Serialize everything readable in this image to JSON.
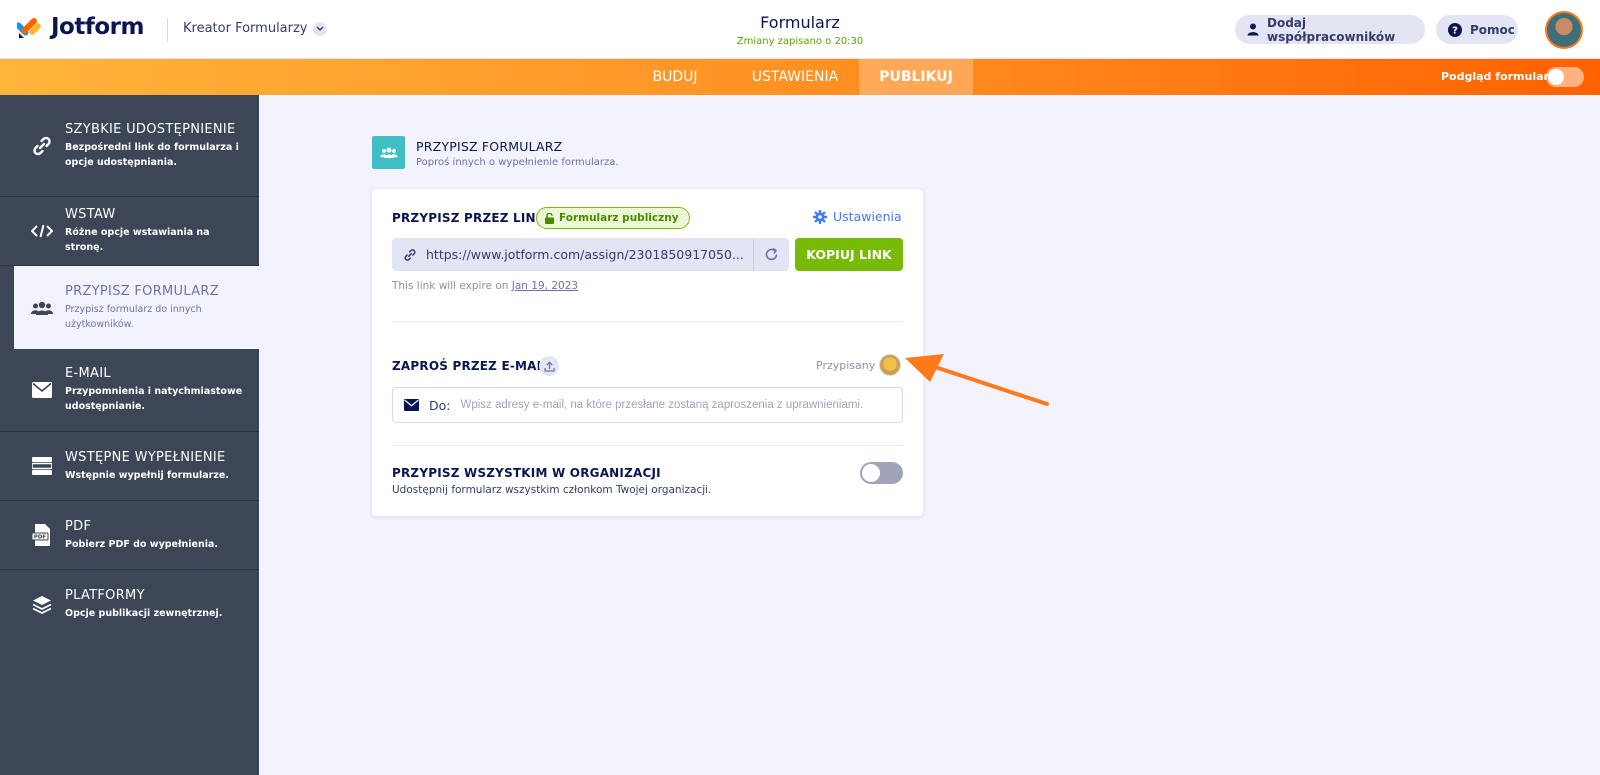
{
  "header": {
    "logo_text": "Jotform",
    "builder_label": "Kreator Formularzy",
    "form_title": "Formularz",
    "saved_status": "Zmiany zapisano o 20:30",
    "add_collaborators": "Dodaj współpracowników",
    "help": "Pomoc"
  },
  "nav": {
    "tabs": [
      "BUDUJ",
      "USTAWIENIA",
      "PUBLIKUJ"
    ],
    "active_tab": "PUBLIKUJ",
    "preview_label": "Podgląd formularza",
    "preview_on": false
  },
  "sidebar": {
    "items": [
      {
        "title": "SZYBKIE UDOSTĘPNIENIE",
        "subtitle": "Bezpośredni link do formularza i opcje udostępniania.",
        "icon": "link-icon"
      },
      {
        "title": "WSTAW",
        "subtitle": "Różne opcje wstawiania na stronę.",
        "icon": "code-icon"
      },
      {
        "title": "PRZYPISZ FORMULARZ",
        "subtitle": "Przypisz formularz do innych użytkowników.",
        "icon": "users-icon"
      },
      {
        "title": "E-MAIL",
        "subtitle": "Przypomnienia i natychmiastowe udostępnianie.",
        "icon": "envelope-icon"
      },
      {
        "title": "WSTĘPNE WYPEŁNIENIE",
        "subtitle": "Wstępnie wypełnij formularze.",
        "icon": "prefill-icon"
      },
      {
        "title": "PDF",
        "subtitle": "Pobierz PDF do wypełnienia.",
        "icon": "pdf-icon"
      },
      {
        "title": "PLATFORMY",
        "subtitle": "Opcje publikacji zewnętrznej.",
        "icon": "layers-icon"
      }
    ],
    "active_index": 2
  },
  "main": {
    "section_title": "PRZYPISZ FORMULARZ",
    "section_subtitle": "Poproś innych o wypełnienie formularza.",
    "assign_link_label": "PRZYPISZ PRZEZ LINK",
    "public_badge": "Formularz publiczny",
    "settings_link": "Ustawienia",
    "link_url": "https://www.jotform.com/assign/2301850917050...",
    "copy_button": "KOPIUJ LINK",
    "expire_prefix": "This link will expire on ",
    "expire_date": "Jan 19, 2023",
    "invite_label": "ZAPROŚ PRZEZ E-MAIL",
    "assigned_label": "Przypisany",
    "to_label": "Do:",
    "email_placeholder": "Wpisz adresy e-mail, na które przesłane zostaną zaproszenia z uprawnieniami.",
    "org_label": "PRZYPISZ WSZYSTKIM W ORGANIZACJI",
    "org_subtitle": "Udostępnij formularz wszystkim członkom Twojej organizacji.",
    "org_toggle_on": false
  },
  "colors": {
    "accent_orange": "#ff6100",
    "green": "#78bb07",
    "navy": "#0a1551",
    "sidebar_bg": "#3c4656",
    "annotation_arrow": "#ff7a1a"
  }
}
